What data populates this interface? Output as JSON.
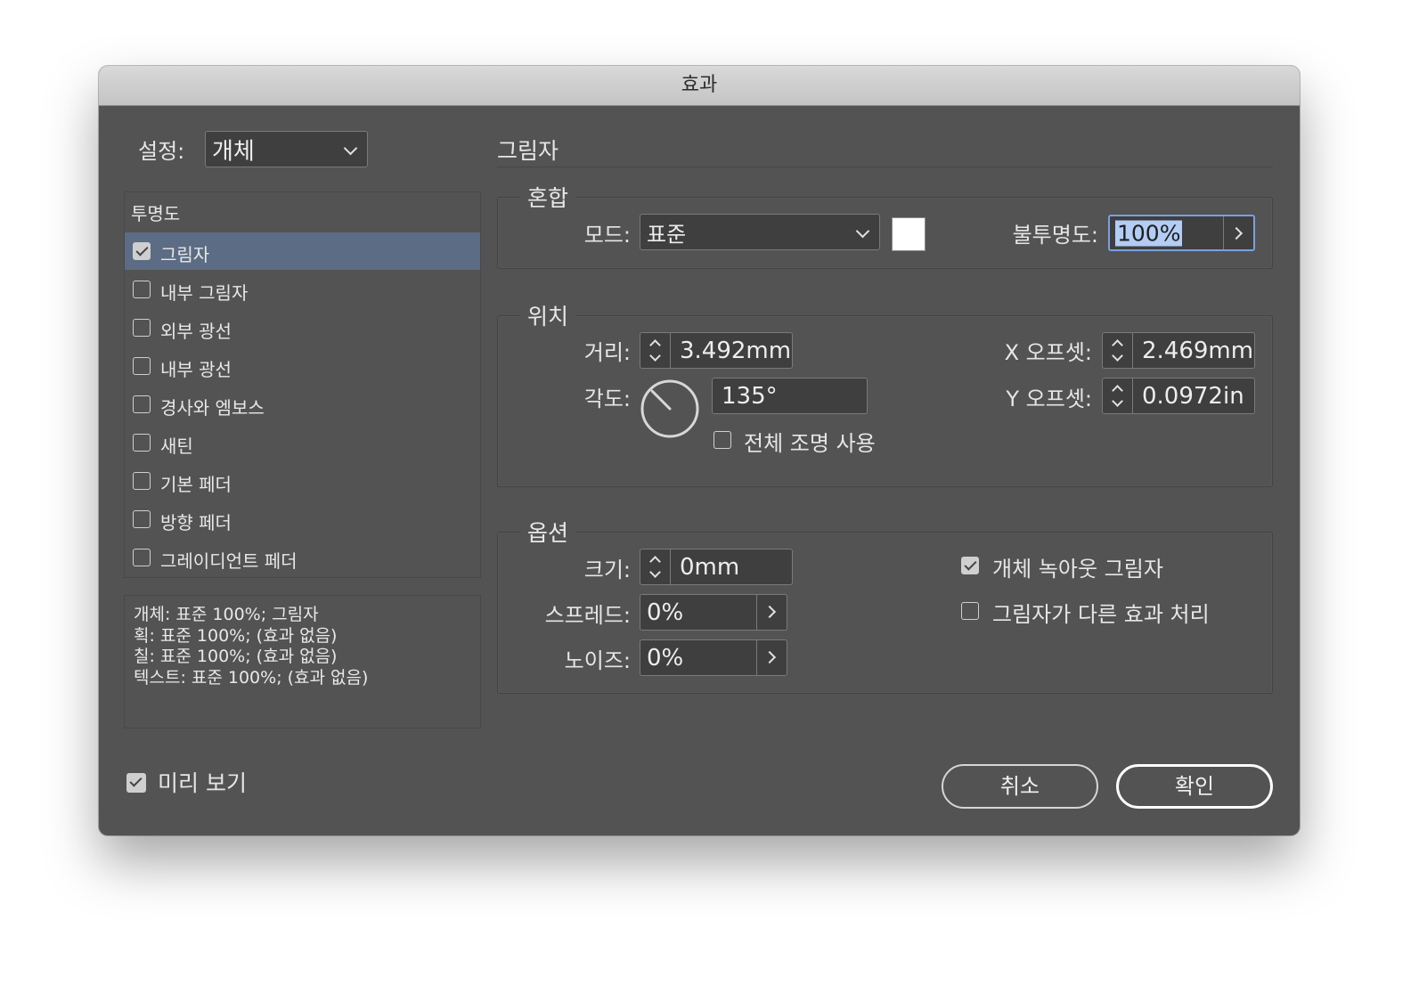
{
  "window": {
    "title": "효과"
  },
  "settings": {
    "label": "설정:",
    "value": "개체"
  },
  "list": {
    "header": "투명도",
    "items": [
      {
        "label": "그림자",
        "checked": true,
        "selected": true
      },
      {
        "label": "내부 그림자",
        "checked": false
      },
      {
        "label": "외부 광선",
        "checked": false
      },
      {
        "label": "내부 광선",
        "checked": false
      },
      {
        "label": "경사와 엠보스",
        "checked": false
      },
      {
        "label": "새틴",
        "checked": false
      },
      {
        "label": "기본 페더",
        "checked": false
      },
      {
        "label": "방향 페더",
        "checked": false
      },
      {
        "label": "그레이디언트 페더",
        "checked": false
      }
    ]
  },
  "summary": {
    "lines": [
      "개체: 표준 100%; 그림자",
      "획: 표준 100%; (효과 없음)",
      "칠: 표준 100%; (효과 없음)",
      "텍스트: 표준 100%; (효과 없음)"
    ]
  },
  "preview": {
    "label": "미리 보기",
    "checked": true
  },
  "section": {
    "title": "그림자"
  },
  "blend": {
    "title": "혼합",
    "mode_label": "모드:",
    "mode_value": "표준",
    "color": "#ffffff",
    "opacity_label": "불투명도:",
    "opacity_value": "100%"
  },
  "position": {
    "title": "위치",
    "distance_label": "거리:",
    "distance_value": "3.492mm",
    "angle_label": "각도:",
    "angle_value": "135°",
    "angle_degrees": 135,
    "global_light_label": "전체 조명 사용",
    "global_light_checked": false,
    "x_offset_label": "X 오프셋:",
    "x_offset_value": "2.469mm",
    "y_offset_label": "Y 오프셋:",
    "y_offset_value": "0.0972in"
  },
  "options": {
    "title": "옵션",
    "size_label": "크기:",
    "size_value": "0mm",
    "spread_label": "스프레드:",
    "spread_value": "0%",
    "noise_label": "노이즈:",
    "noise_value": "0%",
    "knockout_label": "개체 녹아웃 그림자",
    "knockout_checked": true,
    "honor_label": "그림자가 다른 효과 처리",
    "honor_checked": false
  },
  "buttons": {
    "cancel": "취소",
    "ok": "확인"
  },
  "colors": {
    "accent": "#5b6c84",
    "panel": "#535353",
    "field": "#3f3f3f"
  }
}
